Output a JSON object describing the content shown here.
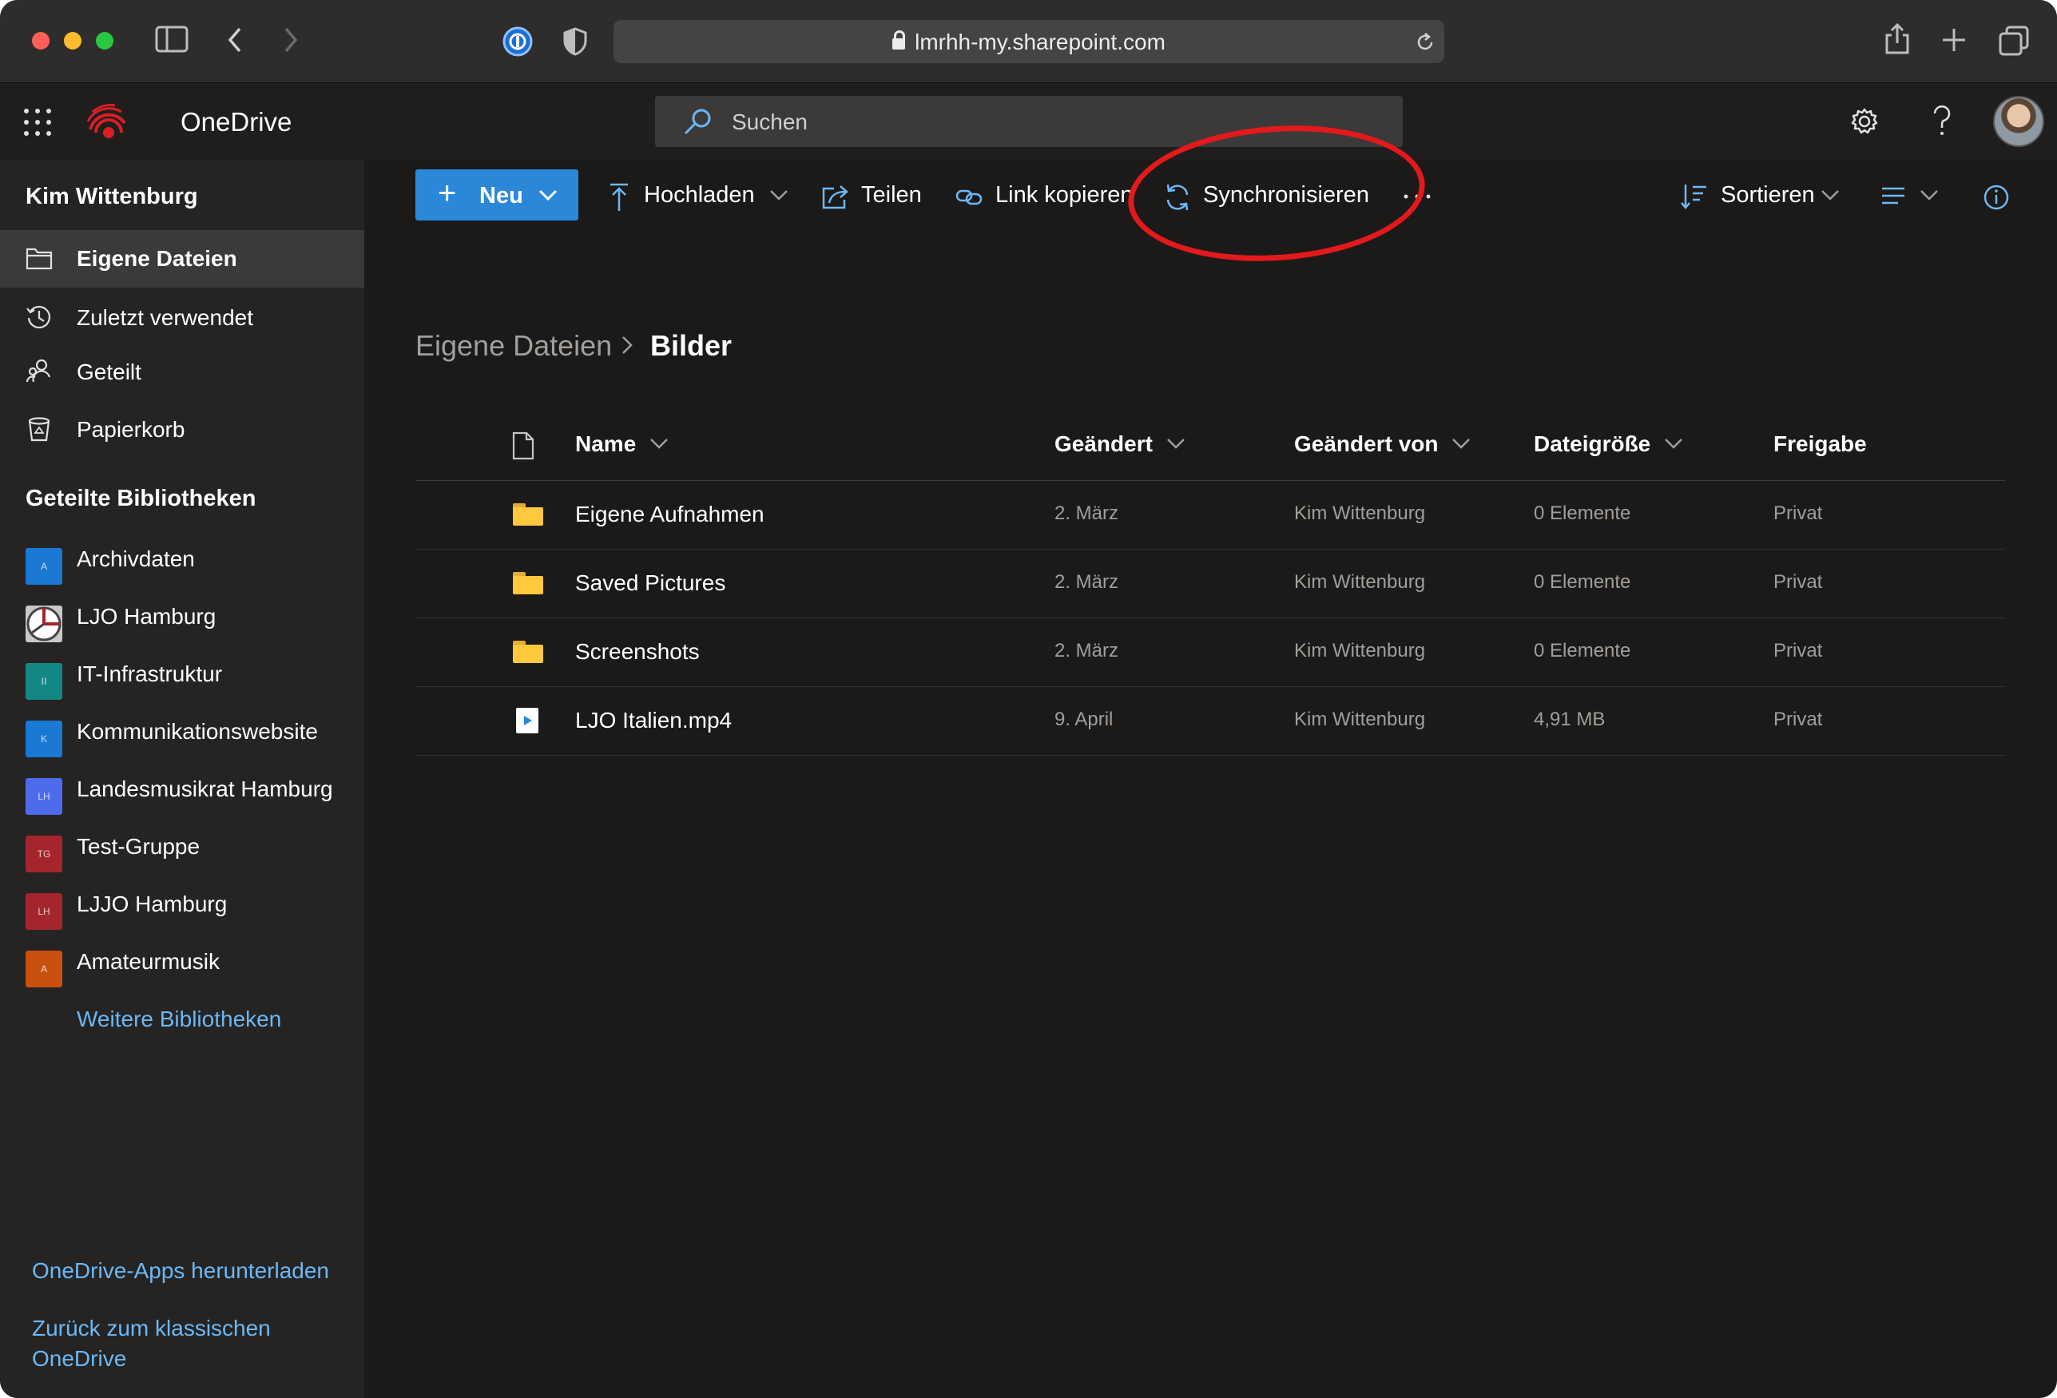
{
  "browser": {
    "url": "lmrhh-my.sharepoint.com"
  },
  "suite": {
    "app_name": "OneDrive",
    "search_placeholder": "Suchen"
  },
  "nav": {
    "user_name": "Kim Wittenburg",
    "items": [
      {
        "label": "Eigene Dateien",
        "icon": "folder-icon",
        "selected": true
      },
      {
        "label": "Zuletzt verwendet",
        "icon": "history-icon",
        "selected": false
      },
      {
        "label": "Geteilt",
        "icon": "people-icon",
        "selected": false
      },
      {
        "label": "Papierkorb",
        "icon": "recycle-bin-icon",
        "selected": false
      }
    ],
    "libraries_heading": "Geteilte Bibliotheken",
    "libraries": [
      {
        "label": "Archivdaten",
        "initials": "A",
        "color": "#1979d3"
      },
      {
        "label": "LJO Hamburg",
        "initials": "",
        "color": "#c9c9c9"
      },
      {
        "label": "IT-Infrastruktur",
        "initials": "II",
        "color": "#138784"
      },
      {
        "label": "Kommunikationswebsite",
        "initials": "K",
        "color": "#1979d3"
      },
      {
        "label": "Landesmusikrat Hamburg",
        "initials": "LH",
        "color": "#4f6bed"
      },
      {
        "label": "Test-Gruppe",
        "initials": "TG",
        "color": "#a4262c"
      },
      {
        "label": "LJJO Hamburg",
        "initials": "LH",
        "color": "#a4262c"
      },
      {
        "label": "Amateurmusik",
        "initials": "A",
        "color": "#ca5010"
      }
    ],
    "more_libraries": "Weitere Bibliotheken",
    "download_apps": "OneDrive-Apps herunterladen",
    "classic_line1": "Zurück zum klassischen",
    "classic_line2": "OneDrive"
  },
  "commands": {
    "new": "Neu",
    "upload": "Hochladen",
    "share": "Teilen",
    "copy_link": "Link kopieren",
    "sync": "Synchronisieren",
    "sort": "Sortieren"
  },
  "breadcrumb": {
    "parent": "Eigene Dateien",
    "current": "Bilder"
  },
  "table": {
    "columns": {
      "name": "Name",
      "modified": "Geändert",
      "modified_by": "Geändert von",
      "size": "Dateigröße",
      "sharing": "Freigabe"
    },
    "rows": [
      {
        "type": "folder",
        "name": "Eigene Aufnahmen",
        "modified": "2. März",
        "modified_by": "Kim Wittenburg",
        "size": "0 Elemente",
        "sharing": "Privat"
      },
      {
        "type": "folder",
        "name": "Saved Pictures",
        "modified": "2. März",
        "modified_by": "Kim Wittenburg",
        "size": "0 Elemente",
        "sharing": "Privat"
      },
      {
        "type": "folder",
        "name": "Screenshots",
        "modified": "2. März",
        "modified_by": "Kim Wittenburg",
        "size": "0 Elemente",
        "sharing": "Privat"
      },
      {
        "type": "video",
        "name": "LJO Italien.mp4",
        "modified": "9. April",
        "modified_by": "Kim Wittenburg",
        "size": "4,91 MB",
        "sharing": "Privat"
      }
    ]
  },
  "colors": {
    "accent": "#2b88d8",
    "link": "#6cb8f6",
    "annotation": "#e3191b"
  }
}
